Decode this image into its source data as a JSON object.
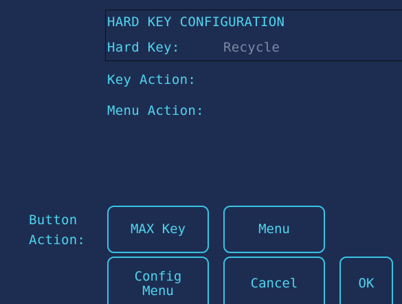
{
  "header": {
    "title": "HARD KEY CONFIGURATION",
    "hard_key_label": "Hard Key:",
    "hard_key_value": "Recycle"
  },
  "fields": {
    "key_action_label": "Key Action:",
    "menu_action_label": "Menu Action:"
  },
  "button_action": {
    "label": "Button\nAction:",
    "buttons": {
      "max_key": "MAX Key",
      "menu": "Menu",
      "config_menu": "Config\nMenu",
      "cancel": "Cancel",
      "ok": "OK"
    }
  },
  "colors": {
    "background": "#1d2d51",
    "text": "#4fd5ef",
    "button_border": "#39c4e6",
    "dim_text": "#7c8aa8"
  }
}
